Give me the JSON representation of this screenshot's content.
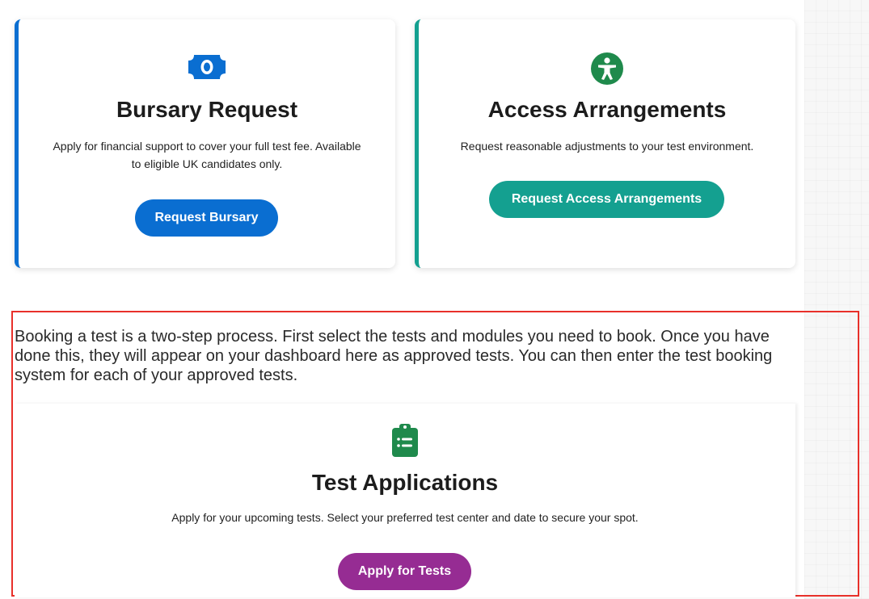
{
  "cards": {
    "bursary": {
      "icon": "money-bill-icon",
      "title": "Bursary Request",
      "description": "Apply for financial support to cover your full test fee. Available to eligible UK candidates only.",
      "button_label": "Request Bursary",
      "accent_color": "#0a6ed1"
    },
    "access": {
      "icon": "accessibility-icon",
      "title": "Access Arrangements",
      "description": "Request reasonable adjustments to your test environment.",
      "button_label": "Request Access Arrangements",
      "accent_color": "#14a090"
    }
  },
  "booking": {
    "intro": "Booking a test is a two-step process. First select the tests and modules you need to book. Once you have done this, they will appear on your dashboard here as approved tests. You can then enter the test booking system for each of your approved tests.",
    "card": {
      "icon": "clipboard-list-icon",
      "title": "Test Applications",
      "description": "Apply for your upcoming tests. Select your preferred test center and date to secure your spot.",
      "button_label": "Apply for Tests",
      "accent_color": "#962c93",
      "icon_color": "#1f8a4c"
    }
  }
}
